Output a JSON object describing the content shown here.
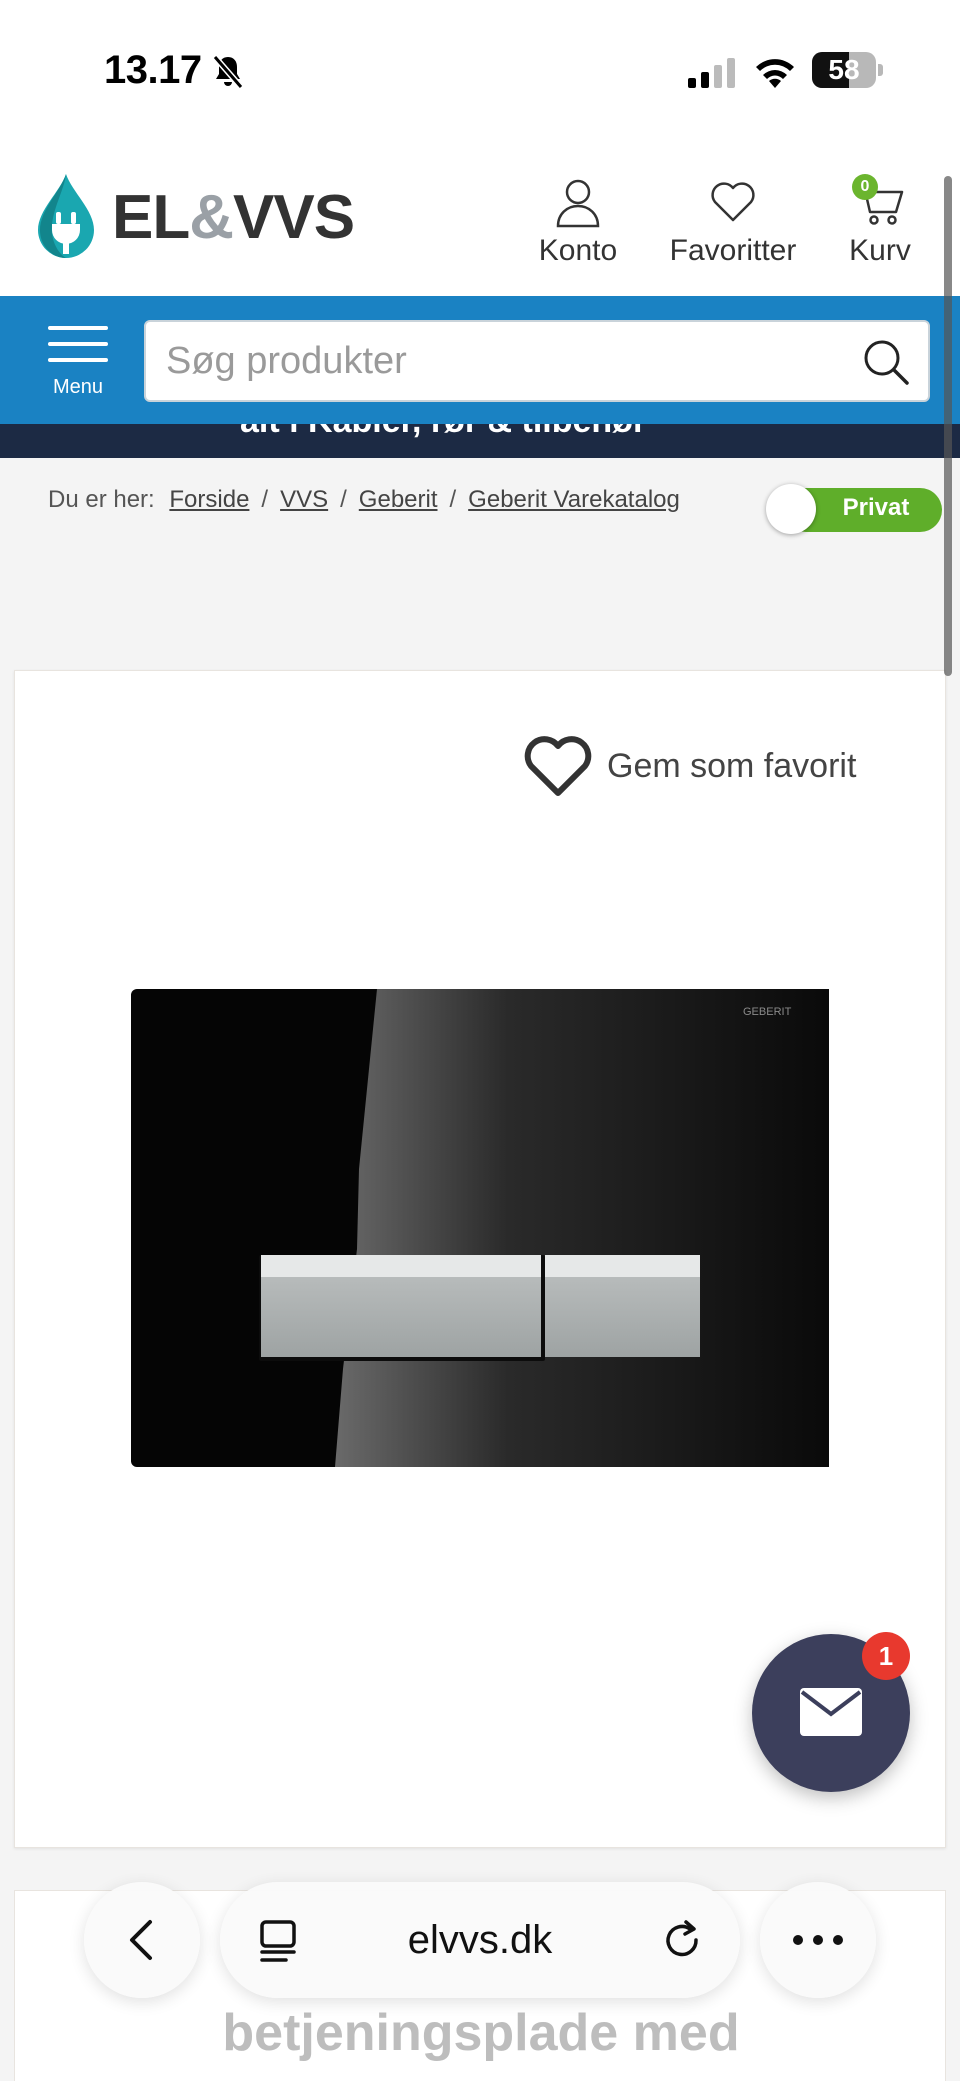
{
  "status_bar": {
    "time": "13.17",
    "battery": "58",
    "battery_level_percent": 58,
    "icons": [
      "bell-slash-icon",
      "cellular-signal-icon",
      "wifi-icon",
      "battery-icon"
    ]
  },
  "header": {
    "logo_part1": "EL",
    "logo_amp": "&",
    "logo_part2": "VVS",
    "account_label": "Konto",
    "favorites_label": "Favoritter",
    "cart_label": "Kurv",
    "cart_count": "0"
  },
  "search": {
    "menu_label": "Menu",
    "placeholder": "Søg produkter",
    "value": ""
  },
  "promo": {
    "text": "alt i Kabler, rør & tilbehør"
  },
  "breadcrumb": {
    "prefix": "Du er her:",
    "items": [
      "Forside",
      "VVS",
      "Geberit",
      "Geberit Varekatalog"
    ],
    "separator": "/"
  },
  "customer_toggle": {
    "label": "Privat"
  },
  "product": {
    "favorite_label": "Gem som favorit",
    "image_brand_text": "GEBERIT",
    "title_peek": "betjeningsplade med"
  },
  "chat": {
    "unread_count": "1"
  },
  "browser": {
    "url": "elvvs.dk"
  },
  "colors": {
    "brand_blue": "#1a82c3",
    "promo_dark": "#1c2a44",
    "toggle_green": "#5fae2a",
    "badge_red": "#e8392e",
    "chat_bg": "#3c3f5c",
    "logo_teal": "#1aa7b0"
  }
}
